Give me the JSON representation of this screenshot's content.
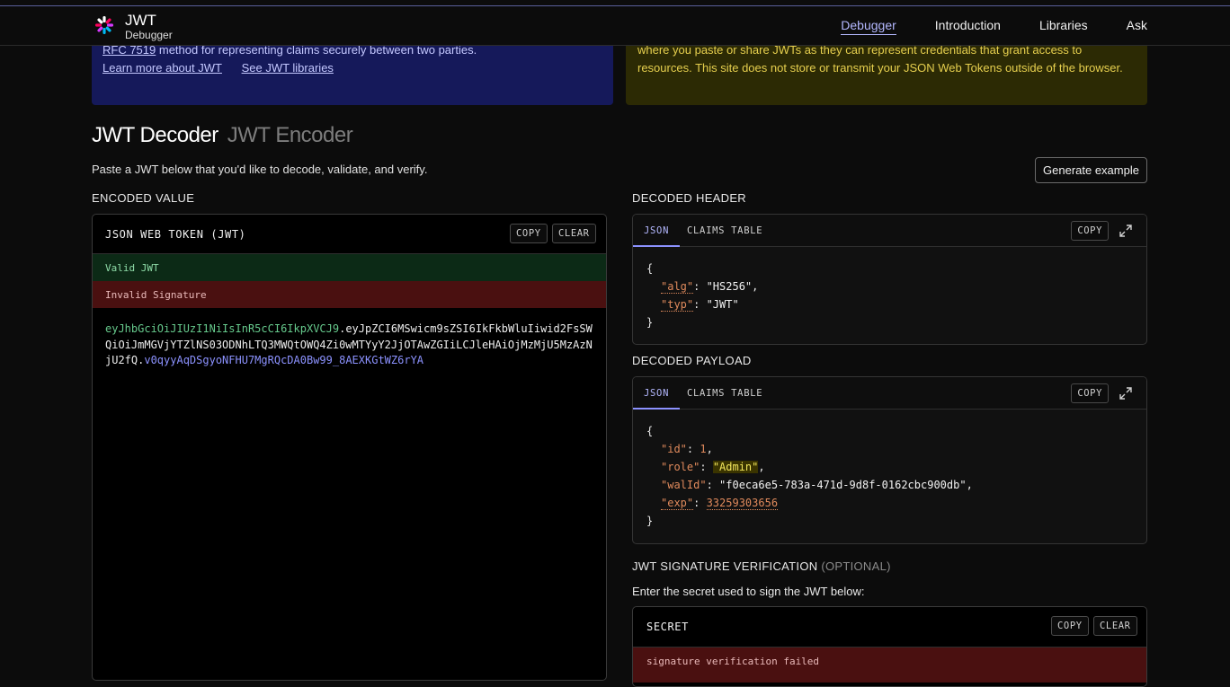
{
  "nav": {
    "brand_title": "JWT",
    "brand_sub": "Debugger",
    "links": [
      "Debugger",
      "Introduction",
      "Libraries",
      "Ask"
    ],
    "active": "Debugger"
  },
  "banner_info": {
    "rfc_link": "RFC 7519",
    "text_after_rfc": " method for representing claims securely between two parties.",
    "learn_more": "Learn more about JWT",
    "see_libraries": "See JWT libraries"
  },
  "banner_warning": {
    "text": "where you paste or share JWTs as they can represent credentials that grant access to resources. This site does not store or transmit your JSON Web Tokens outside of the browser."
  },
  "mode_tabs": {
    "decoder": "JWT Decoder",
    "encoder": "JWT Encoder"
  },
  "lead": "Paste a JWT below that you'd like to decode, validate, and verify.",
  "generate_example": "Generate example",
  "encoded": {
    "section_label": "ENCODED VALUE",
    "panel_title": "JSON WEB TOKEN (JWT)",
    "copy": "COPY",
    "clear": "CLEAR",
    "status_valid": "Valid JWT",
    "status_signature": "Invalid Signature",
    "token_header": "eyJhbGciOiJIUzI1NiIsInR5cCI6IkpXVCJ9",
    "token_payload": "eyJpZCI6MSwicm9sZSI6IkFkbWluIiwid2FsSWQiOiJmMGVjYTZlNS03ODNhLTQ3MWQtOWQ4Zi0wMTYyY2JjOTAwZGIiLCJleHAiOjMzMjU5MzAzNjU2fQ",
    "token_signature": "v0qyyAqDSgyoNFHU7MgRQcDA0Bw99_8AEXKGtWZ6rYA",
    "dot": "."
  },
  "decoded_header": {
    "section_label": "DECODED HEADER",
    "tab_json": "JSON",
    "tab_claims": "CLAIMS TABLE",
    "copy": "COPY",
    "alg_key": "\"alg\"",
    "alg_val": "\"HS256\"",
    "typ_key": "\"typ\"",
    "typ_val": "\"JWT\""
  },
  "decoded_payload": {
    "section_label": "DECODED PAYLOAD",
    "tab_json": "JSON",
    "tab_claims": "CLAIMS TABLE",
    "copy": "COPY",
    "id_key": "\"id\"",
    "id_val": "1",
    "role_key": "\"role\"",
    "role_val": "\"Admin\"",
    "walid_key": "\"walId\"",
    "walid_val": "\"f0eca6e5-783a-471d-9d8f-0162cbc900db\"",
    "exp_key": "\"exp\"",
    "exp_val": "33259303656"
  },
  "signature": {
    "section_label": "JWT SIGNATURE VERIFICATION",
    "optional": "(OPTIONAL)",
    "lead": "Enter the secret used to sign the JWT below:",
    "panel_title": "SECRET",
    "copy": "COPY",
    "clear": "CLEAR",
    "status": "signature verification failed"
  },
  "colors": {
    "accent": "#8c92ff",
    "valid_bg": "#0c2a16",
    "invalid_bg": "#4a1010",
    "info_banner": "#15195a",
    "warning_banner": "#2c2a04"
  }
}
